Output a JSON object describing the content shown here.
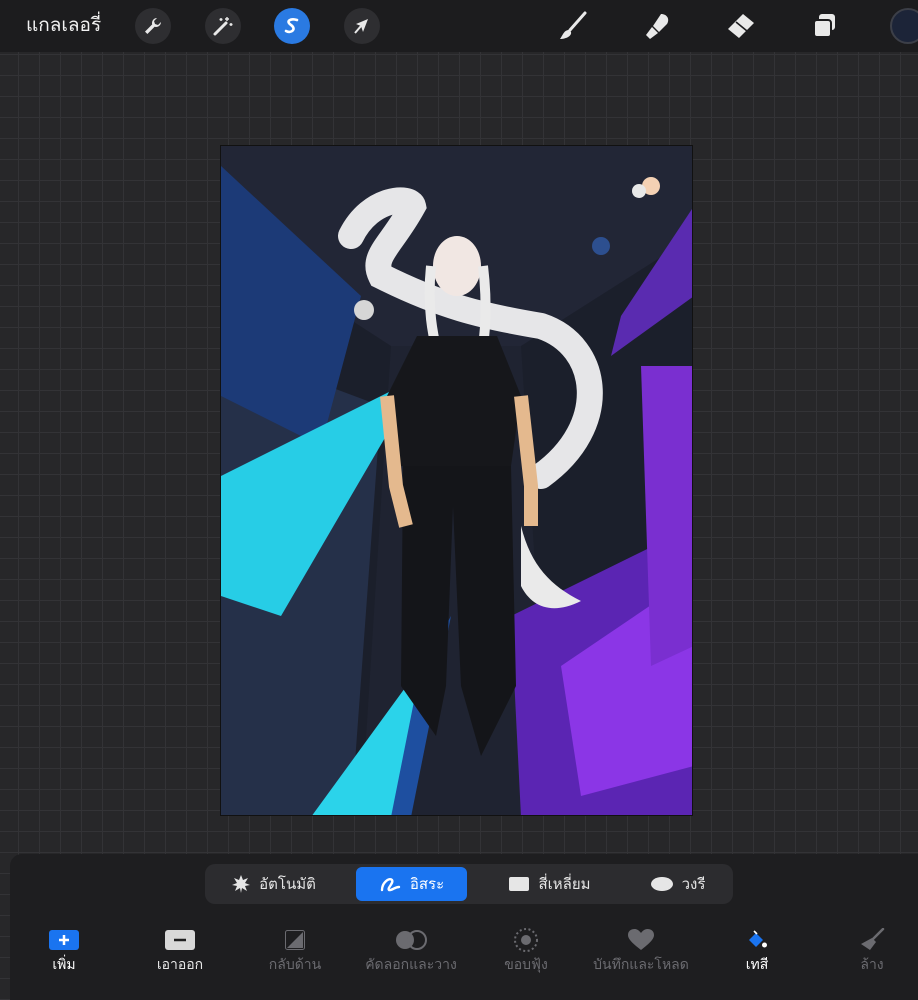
{
  "app": {
    "gallery_label": "แกลเลอรี่",
    "tools_left": [
      "wrench-icon",
      "magic-wand-icon",
      "selection-s-icon",
      "arrow-transform-icon"
    ],
    "tools_right": [
      "brush-icon",
      "smudge-icon",
      "eraser-icon",
      "layers-icon"
    ],
    "accent_color": "#2a7ae2",
    "current_color": "#1c2438"
  },
  "selection_modes": [
    {
      "label": "อัตโนมัติ",
      "icon": "auto-burst-icon",
      "active": false
    },
    {
      "label": "อิสระ",
      "icon": "freehand-icon",
      "active": true
    },
    {
      "label": "สี่เหลี่ยม",
      "icon": "rectangle-icon",
      "active": false
    },
    {
      "label": "วงรี",
      "icon": "ellipse-icon",
      "active": false
    }
  ],
  "actions": [
    {
      "label": "เพิ่ม",
      "icon": "add-icon",
      "state": "normal"
    },
    {
      "label": "เอาออก",
      "icon": "remove-icon",
      "state": "normal"
    },
    {
      "label": "กลับด้าน",
      "icon": "invert-icon",
      "state": "disabled"
    },
    {
      "label": "คัดลอกและวาง",
      "icon": "copy-paste-icon",
      "state": "disabled"
    },
    {
      "label": "ขอบฟุ้ง",
      "icon": "feather-icon",
      "state": "disabled"
    },
    {
      "label": "บันทึกและโหลด",
      "icon": "heart-icon",
      "state": "disabled"
    },
    {
      "label": "เทสี",
      "icon": "paint-bucket-icon",
      "state": "active"
    },
    {
      "label": "ล้าง",
      "icon": "clear-broom-icon",
      "state": "disabled"
    }
  ]
}
